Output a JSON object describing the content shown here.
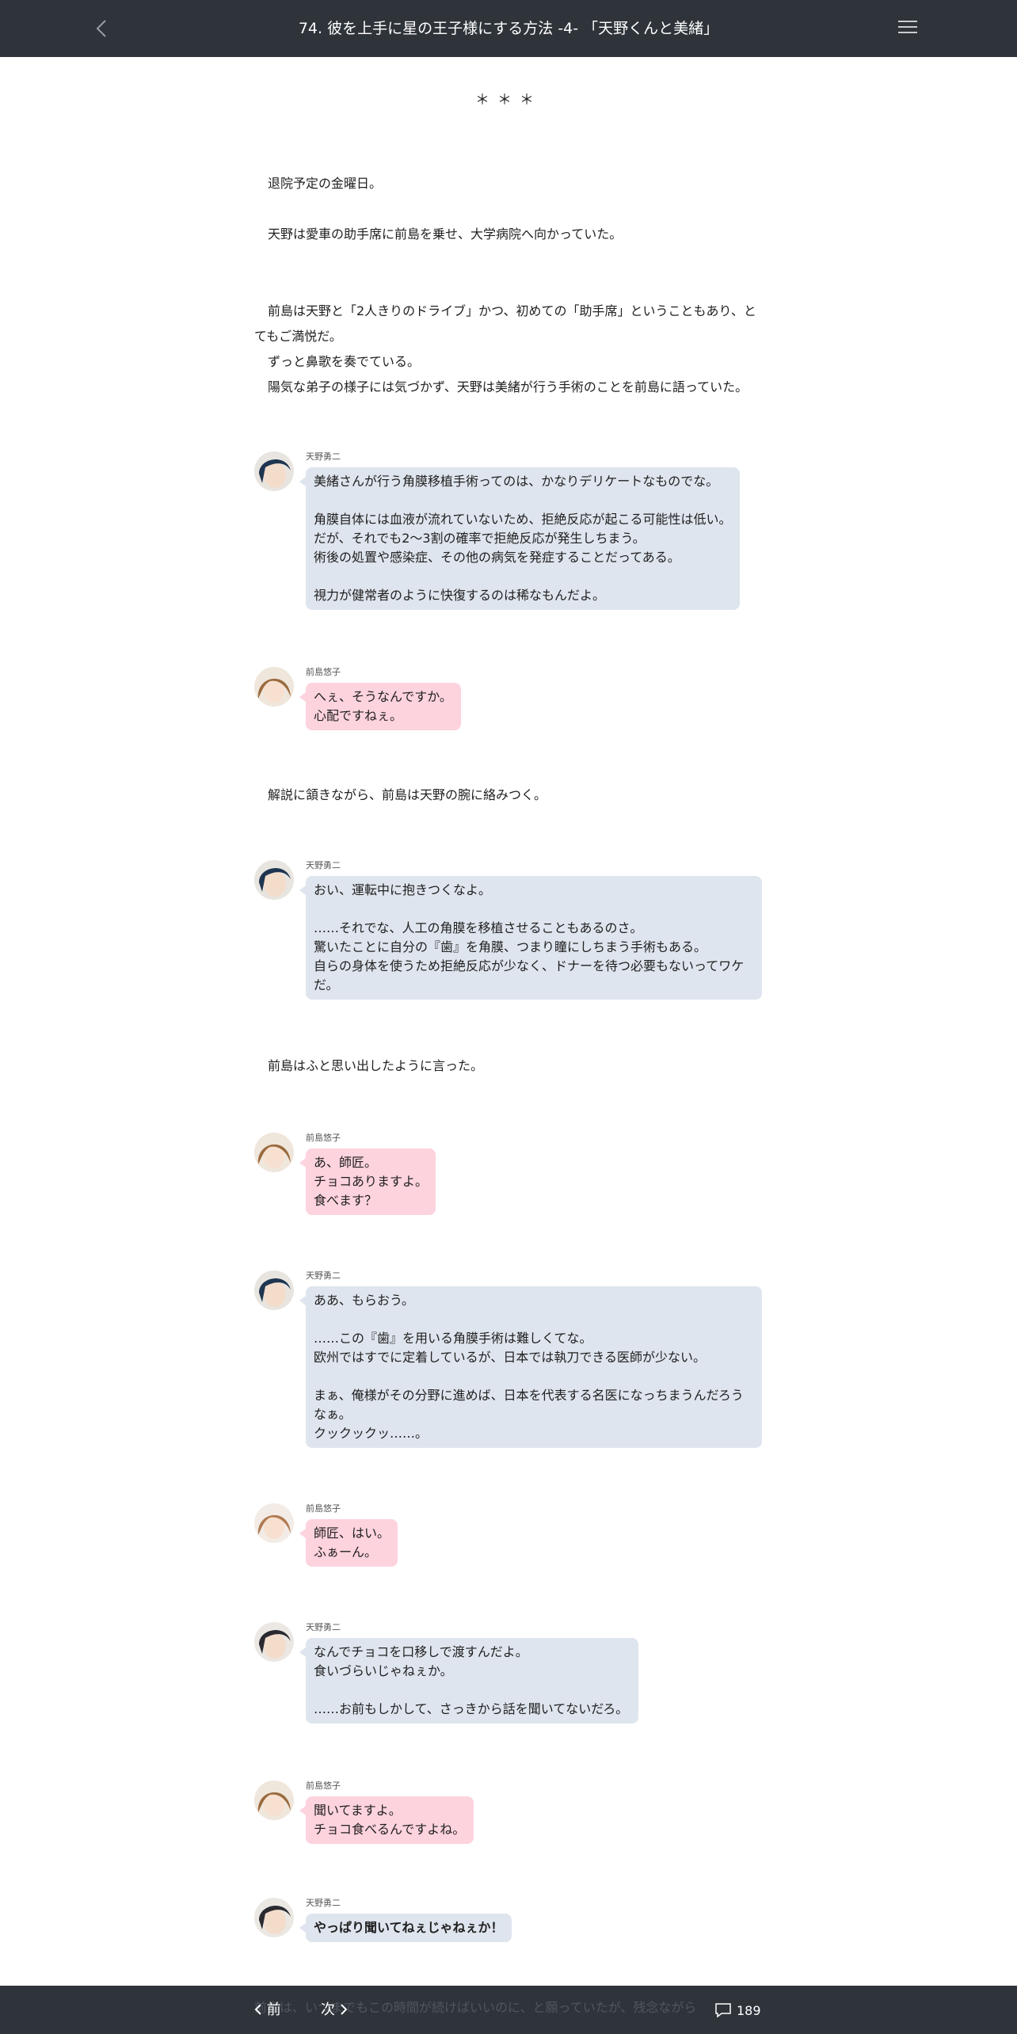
{
  "header": {
    "title": "74. 彼を上手に星の王子様にする方法 -4- 「天野くんと美緒」",
    "back_icon": "chevron-left-icon",
    "menu_icon": "hamburger-menu-icon"
  },
  "story": {
    "separator": "＊＊＊",
    "p1": "退院予定の金曜日。",
    "p2": "天野は愛車の助手席に前島を乗せ、大学病院へ向かっていた。",
    "p3": {
      "l1": "前島は天野と「2人きりのドライブ」かつ、初めての「助手席」ということもあり、と",
      "l2": "てもご満悦だ。",
      "l3": "ずっと鼻歌を奏でている。",
      "l4": "陽気な弟子の様子には気づかず、天野は美緒が行う手術のことを前島に語っていた。"
    },
    "p4": "解説に頷きながら、前島は天野の腕に絡みつく。",
    "p5": "前島はふと思い出したように言った。"
  },
  "chats": {
    "c1": {
      "speaker": "天野勇二",
      "lines": [
        "美緒さんが行う角膜移植手術ってのは、かなりデリケートなものでな。",
        "角膜自体には血液が流れていないため、拒絶反応が起こる可能性は低い。",
        "だが、それでも2～3割の確率で拒絶反応が発生しちまう。",
        "術後の処置や感染症、その他の病気を発症することだってある。",
        "視力が健常者のように快復するのは稀なもんだよ。"
      ]
    },
    "c2": {
      "speaker": "前島悠子",
      "lines": [
        "へぇ、そうなんですか。",
        "心配ですねぇ。"
      ]
    },
    "c3": {
      "speaker": "天野勇二",
      "lines": [
        "おい、運転中に抱きつくなよ。",
        "……それでな、人工の角膜を移植させることもあるのさ。",
        "驚いたことに自分の『歯』を角膜、つまり瞳にしちまう手術もある。",
        "自らの身体を使うため拒絶反応が少なく、ドナーを待つ必要もないってワケ",
        "だ。"
      ]
    },
    "c4": {
      "speaker": "前島悠子",
      "lines": [
        "あ、師匠。",
        "チョコありますよ。",
        "食べます？"
      ]
    },
    "c5": {
      "speaker": "天野勇二",
      "lines": [
        "ああ、もらおう。",
        "……この『歯』を用いる角膜手術は難しくてな。",
        "欧州ではすでに定着しているが、日本では執刀できる医師が少ない。",
        "まぁ、俺様がその分野に進めば、日本を代表する名医になっちまうんだろう",
        "なぁ。",
        "クックックッ……。"
      ]
    },
    "c6": {
      "speaker": "前島悠子",
      "lines": [
        "師匠、はい。",
        "ふぁーん。"
      ]
    },
    "c7": {
      "speaker": "天野勇二",
      "lines": [
        "なんでチョコを口移しで渡すんだよ。",
        "食いづらいじゃねぇか。",
        "……お前もしかして、さっきから話を聞いてないだろ。"
      ]
    },
    "c8": {
      "speaker": "前島悠子",
      "lines": [
        "聞いてますよ。",
        "チョコ食べるんですよね。"
      ]
    },
    "c9": {
      "speaker": "天野勇二",
      "lines": [
        "やっぱり聞いてねぇじゃねぇか！"
      ]
    }
  },
  "footer": {
    "prev_label": "前",
    "next_label": "次",
    "comment_count": "189",
    "comment_icon": "comment-bubble-icon",
    "behind_text": "前島は、いつまでもこの時間が続けばいいのに、と願っていたが、残念ながら"
  },
  "colors": {
    "bar_bg": "#2f343b",
    "amano_bubble": "#dfe5ee",
    "maeshima_bubble": "#fdd3de"
  }
}
